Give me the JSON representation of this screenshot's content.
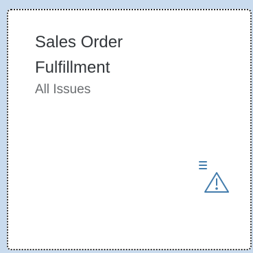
{
  "tile": {
    "title_line1": "Sales Order",
    "title_line2": "Fulfillment",
    "subtitle": "All Issues",
    "icon": "list-warning-icon",
    "icon_color": "#427cac",
    "text_color": "#32363a",
    "subtitle_color": "#6a6d70"
  }
}
